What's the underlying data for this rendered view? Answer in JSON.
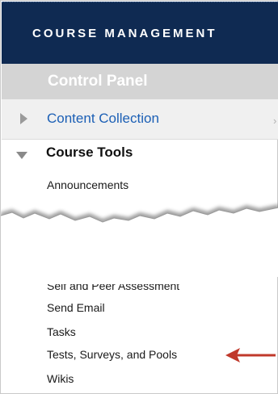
{
  "header": {
    "title": "COURSE MANAGEMENT"
  },
  "control_panel": {
    "label": "Control Panel"
  },
  "content_collection": {
    "label": "Content Collection",
    "chevron": "›"
  },
  "course_tools": {
    "label": "Course Tools",
    "items": [
      "Announcements",
      "Self and Peer Assessment",
      "Send Email",
      "Tasks",
      "Tests, Surveys, and Pools",
      "Wikis"
    ]
  },
  "colors": {
    "header_bg": "#0f2a52",
    "control_panel_bg": "#d4d4d4",
    "link_blue": "#1b5fb5",
    "arrow_red": "#c0392b"
  },
  "icons": {
    "collapsed": "triangle-right-icon",
    "expanded": "triangle-down-icon",
    "pointer": "red-arrow-icon"
  }
}
